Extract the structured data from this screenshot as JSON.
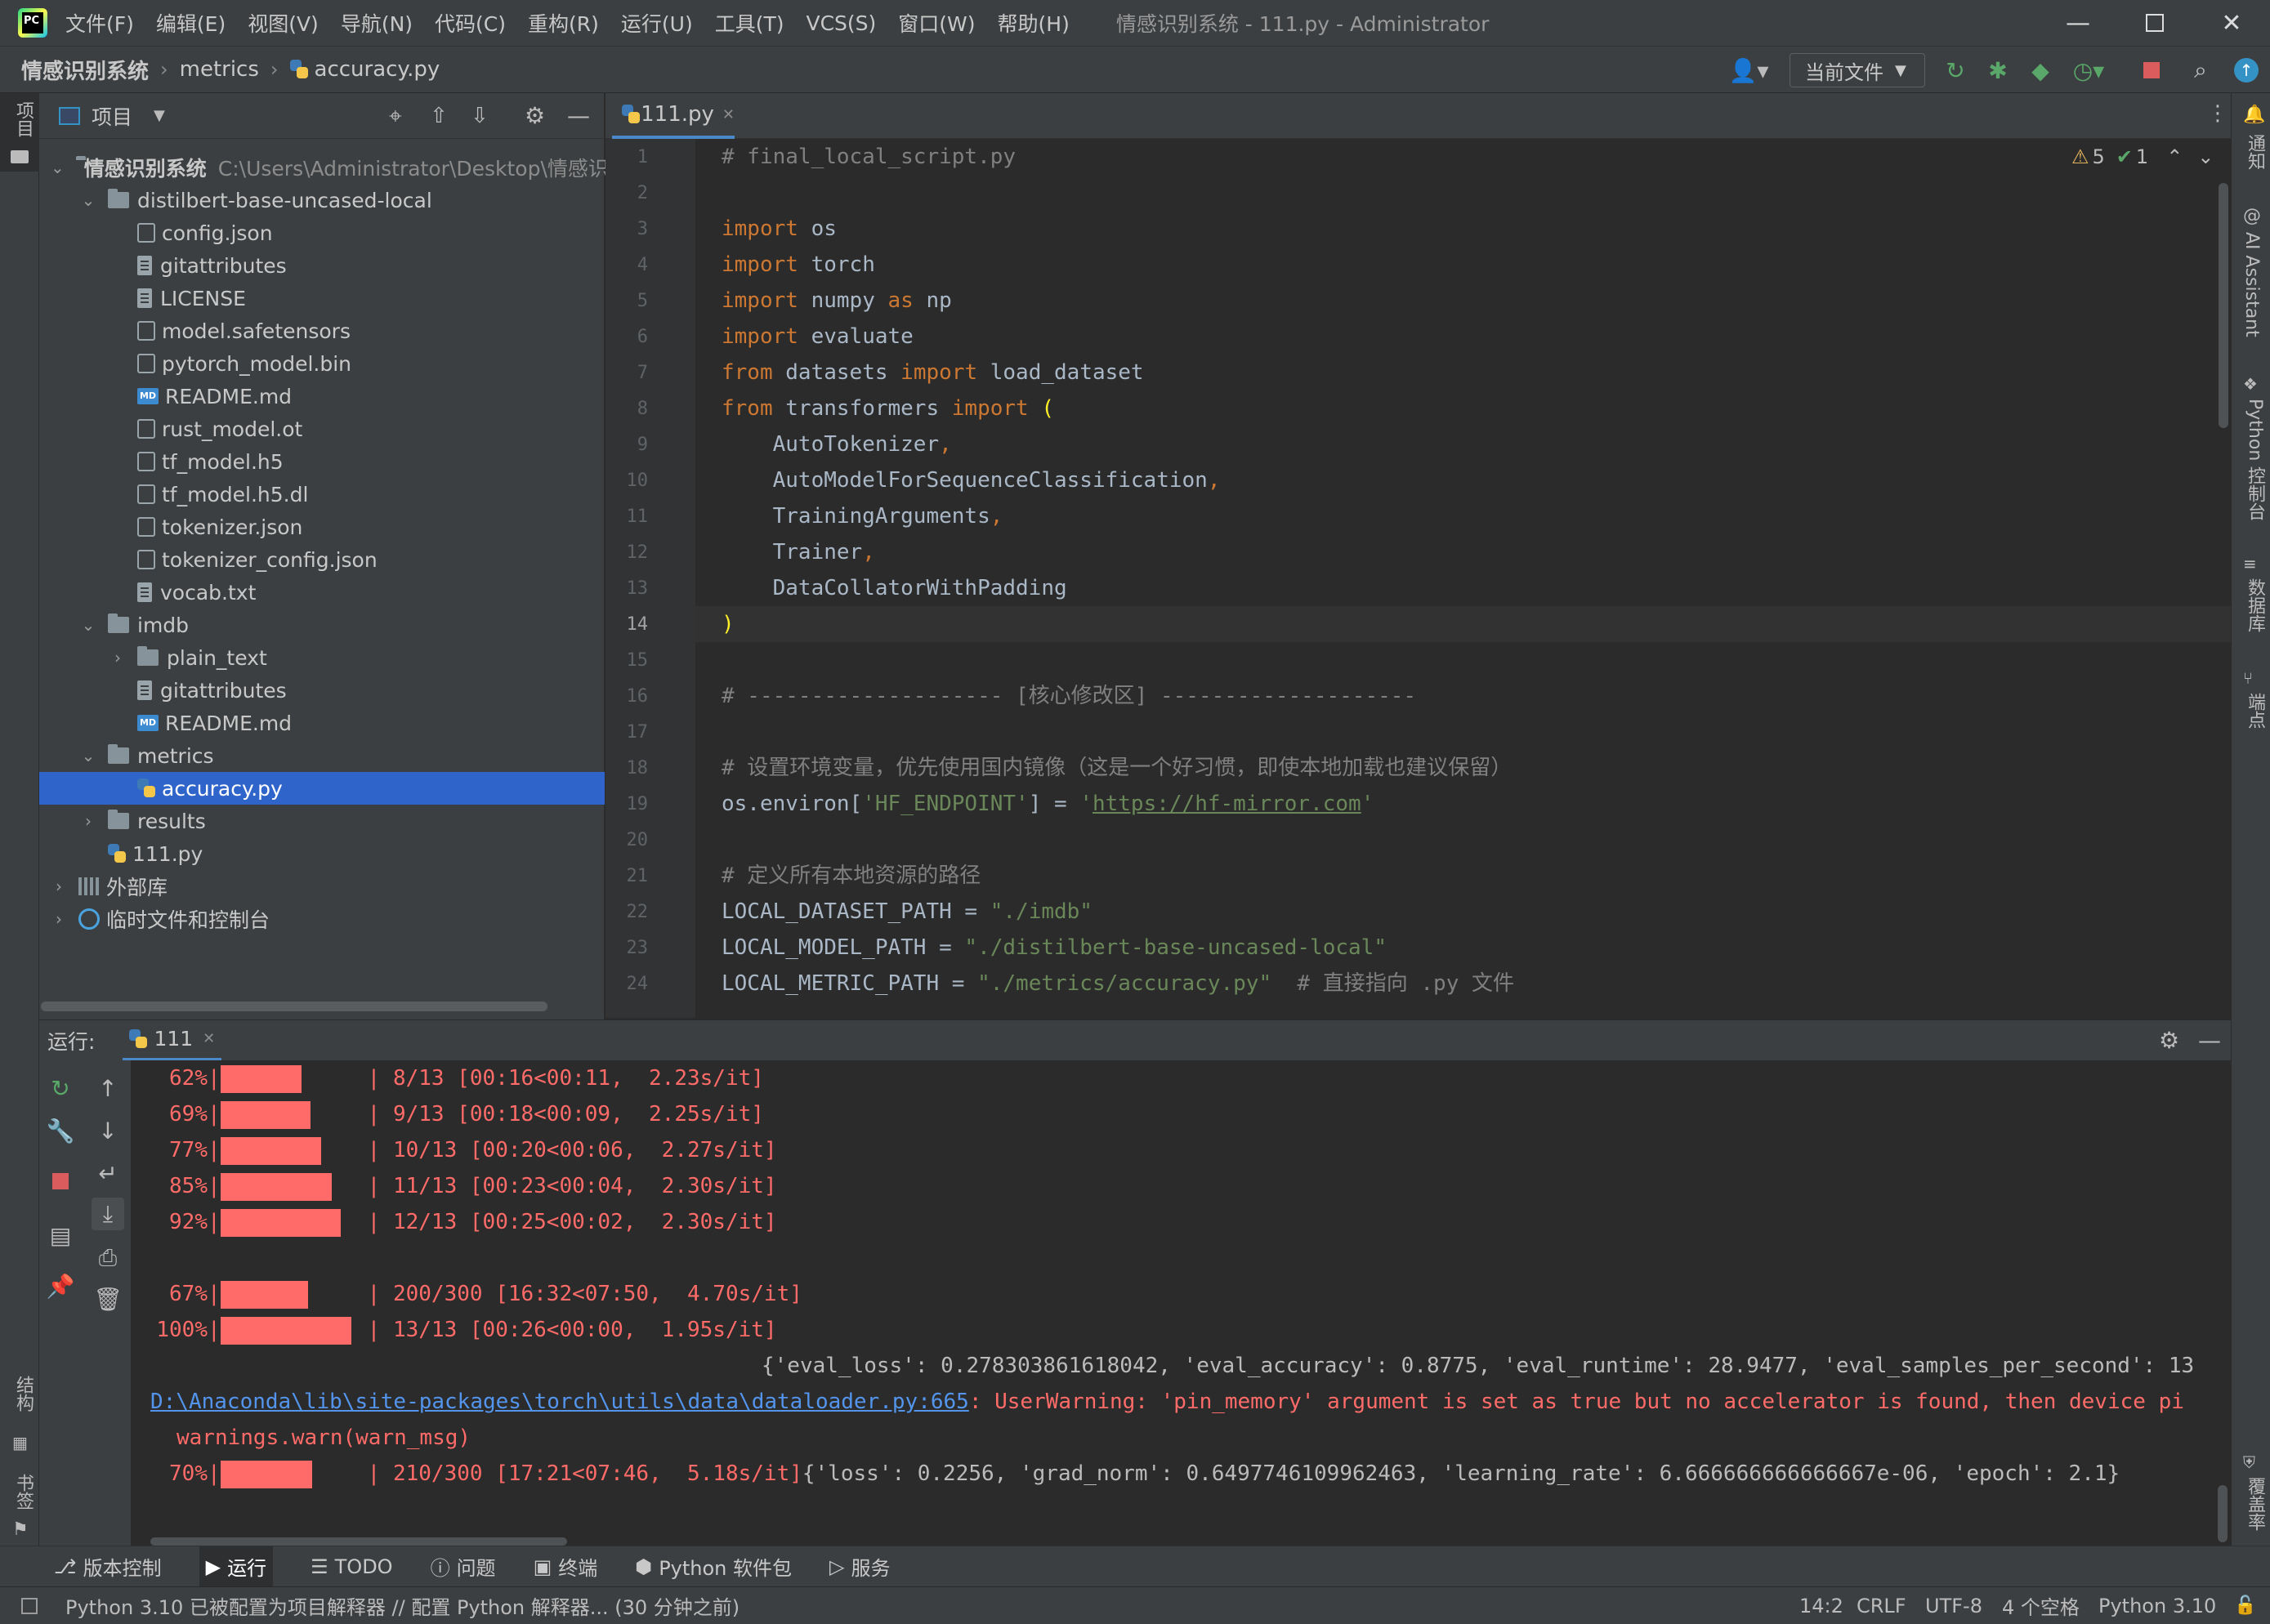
{
  "titlebar": {
    "menus": [
      "文件(F)",
      "编辑(E)",
      "视图(V)",
      "导航(N)",
      "代码(C)",
      "重构(R)",
      "运行(U)",
      "工具(T)",
      "VCS(S)",
      "窗口(W)",
      "帮助(H)"
    ],
    "window_title": "情感识别系统 - 111.py - Administrator"
  },
  "navbar": {
    "breadcrumb": [
      "情感识别系统",
      "metrics",
      "accuracy.py"
    ],
    "run_config": "当前文件"
  },
  "left_strip": {
    "project_label": "项目",
    "structure_label": "结构",
    "bookmarks_label": "书签"
  },
  "right_strip": {
    "labels": [
      "通知",
      "AI Assistant",
      "Python 控制台",
      "数据库",
      "端点",
      "覆盖率"
    ]
  },
  "project": {
    "header_label": "项目",
    "root_name": "情感识别系统",
    "root_path": "C:\\Users\\Administrator\\Desktop\\情感识",
    "items": [
      {
        "label": "distilbert-base-uncased-local",
        "kind": "folder",
        "expanded": true
      },
      {
        "label": "config.json",
        "kind": "config"
      },
      {
        "label": "gitattributes",
        "kind": "text"
      },
      {
        "label": "LICENSE",
        "kind": "text"
      },
      {
        "label": "model.safetensors",
        "kind": "unknown"
      },
      {
        "label": "pytorch_model.bin",
        "kind": "unknown"
      },
      {
        "label": "README.md",
        "kind": "markdown"
      },
      {
        "label": "rust_model.ot",
        "kind": "unknown"
      },
      {
        "label": "tf_model.h5",
        "kind": "unknown"
      },
      {
        "label": "tf_model.h5.dl",
        "kind": "unknown"
      },
      {
        "label": "tokenizer.json",
        "kind": "config"
      },
      {
        "label": "tokenizer_config.json",
        "kind": "config"
      },
      {
        "label": "vocab.txt",
        "kind": "text"
      },
      {
        "label": "imdb",
        "kind": "folder",
        "expanded": true
      },
      {
        "label": "plain_text",
        "kind": "folder",
        "expanded": false
      },
      {
        "label": "gitattributes",
        "kind": "text"
      },
      {
        "label": "README.md",
        "kind": "markdown"
      },
      {
        "label": "metrics",
        "kind": "folder",
        "expanded": true
      },
      {
        "label": "accuracy.py",
        "kind": "python",
        "selected": true
      },
      {
        "label": "results",
        "kind": "folder",
        "expanded": false
      },
      {
        "label": "111.py",
        "kind": "python"
      },
      {
        "label": "外部库",
        "kind": "library"
      },
      {
        "label": "临时文件和控制台",
        "kind": "scratch"
      }
    ]
  },
  "editor": {
    "tab_label": "111.py",
    "inspections": {
      "warnings": "5",
      "weak_warnings": "1"
    },
    "current_line": 14,
    "line_numbers": [
      "1",
      "2",
      "3",
      "4",
      "5",
      "6",
      "7",
      "8",
      "9",
      "10",
      "11",
      "12",
      "13",
      "14",
      "15",
      "16",
      "17",
      "18",
      "19",
      "20",
      "21",
      "22",
      "23",
      "24"
    ]
  },
  "run": {
    "label": "运行:",
    "tab_label": "111",
    "progress_lines": [
      {
        "pct": "62%",
        "fraction": 0.62,
        "rest": "| 8/13 [00:16<00:11,  2.23s/it]"
      },
      {
        "pct": "69%",
        "fraction": 0.69,
        "rest": "| 9/13 [00:18<00:09,  2.25s/it]"
      },
      {
        "pct": "77%",
        "fraction": 0.77,
        "rest": "| 10/13 [00:20<00:06,  2.27s/it]"
      },
      {
        "pct": "85%",
        "fraction": 0.85,
        "rest": "| 11/13 [00:23<00:04,  2.30s/it]"
      },
      {
        "pct": "92%",
        "fraction": 0.92,
        "rest": "| 12/13 [00:25<00:02,  2.30s/it]"
      }
    ],
    "train_line": {
      "pct": "67%",
      "fraction": 0.67,
      "rest": "| 200/300 [16:32<07:50,  4.70s/it]"
    },
    "eval_done": {
      "pct": "100%",
      "fraction": 1.0,
      "rest": "| 13/13 [00:26<00:00,  1.95s/it]"
    },
    "eval_metrics": "{'eval_loss': 0.278303861618042, 'eval_accuracy': 0.8775, 'eval_runtime': 28.9477, 'eval_samples_per_second': 13",
    "warning_link": "D:\\Anaconda\\lib\\site-packages\\torch\\utils\\data\\dataloader.py:665",
    "warning_text": ": UserWarning: 'pin_memory' argument is set as true but no accelerator is found, then device pi",
    "warn_call": "warnings.warn(warn_msg)",
    "last_line": {
      "pct": "70%",
      "fraction": 0.7,
      "rest": "| 210/300 [17:21<07:46,  5.18s/it]",
      "log": "{'loss': 0.2256, 'grad_norm': 0.6497746109962463, 'learning_rate': 6.666666666666667e-06, 'epoch': 2.1}"
    }
  },
  "bottom_tools": [
    "版本控制",
    "运行",
    "TODO",
    "问题",
    "终端",
    "Python 软件包",
    "服务"
  ],
  "status": {
    "interpreter_msg": "Python 3.10 已被配置为项目解释器 // 配置 Python 解释器... (30 分钟之前)",
    "position": "14:2",
    "line_sep": "CRLF",
    "encoding": "UTF-8",
    "indent": "4 个空格",
    "interpreter": "Python 3.10"
  },
  "colors": {
    "accent": "#2f65ca",
    "keyword": "#cc7832",
    "string": "#6a8759",
    "console_red": "#ff6b68"
  }
}
